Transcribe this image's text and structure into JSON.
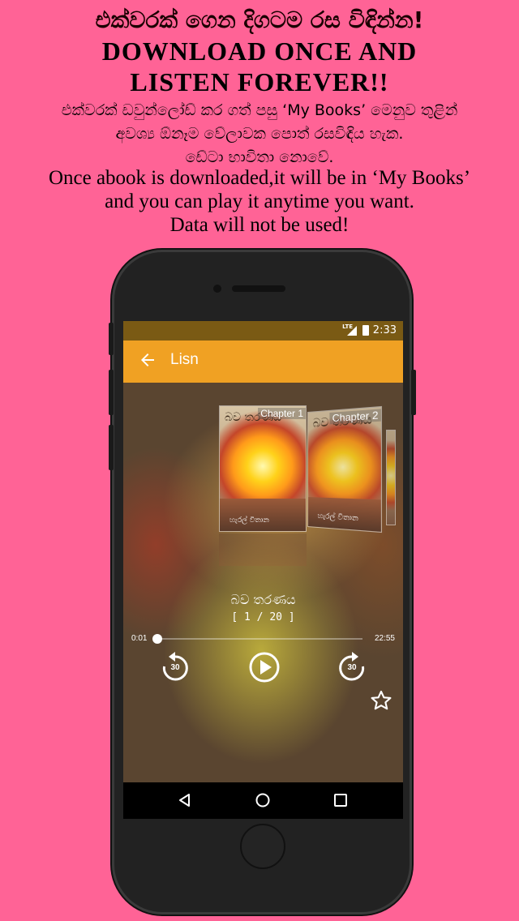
{
  "promo": {
    "headline_si": "එක්වරක් ගෙන දිගටම රස විඳින්න!",
    "headline_en": [
      "DOWNLOAD ONCE AND",
      "LISTEN FOREVER!!"
    ],
    "desc_si": [
      "එක්වරක් ඩවුන්ලෝඩ් කර ගත් පසු ‘My Books’ මෙනුව තුළින්",
      "අවශ්‍ය ඕනෑම වේලාවක පොත් රසවිඳිය හැක.",
      "ඩේටා භාවිතා නොවේ."
    ],
    "desc_en": [
      "Once abook is downloaded,it will be in ‘My Books’",
      "and you can play it anytime you want.",
      "Data will not be used!"
    ]
  },
  "status_bar": {
    "network": "LTE",
    "time": "2:33"
  },
  "app_bar": {
    "title": "Lisn",
    "back_icon": "arrow-back-icon"
  },
  "player": {
    "covers": [
      {
        "chapter": "Chapter 1",
        "title_script": "බව තරණය",
        "author": "හැරල් විතාන"
      },
      {
        "chapter": "Chapter 2",
        "title_script": "බව තරණය",
        "author": "හැරල් විතාන"
      }
    ],
    "book_title": "බව තරණය",
    "chapter_count": "[ 1 / 20 ]",
    "elapsed": "0:01",
    "total": "22:55",
    "progress": 0.001,
    "rewind_label": "30",
    "forward_label": "30",
    "icons": [
      "replay-30-icon",
      "play-icon",
      "forward-30-icon",
      "star-outline-icon"
    ]
  },
  "nav_bar": {
    "icons": [
      "nav-back-icon",
      "nav-home-icon",
      "nav-recents-icon"
    ]
  },
  "colors": {
    "background": "#ff6396",
    "app_bar": "#f0a123",
    "status_bar": "#7a5a14"
  }
}
